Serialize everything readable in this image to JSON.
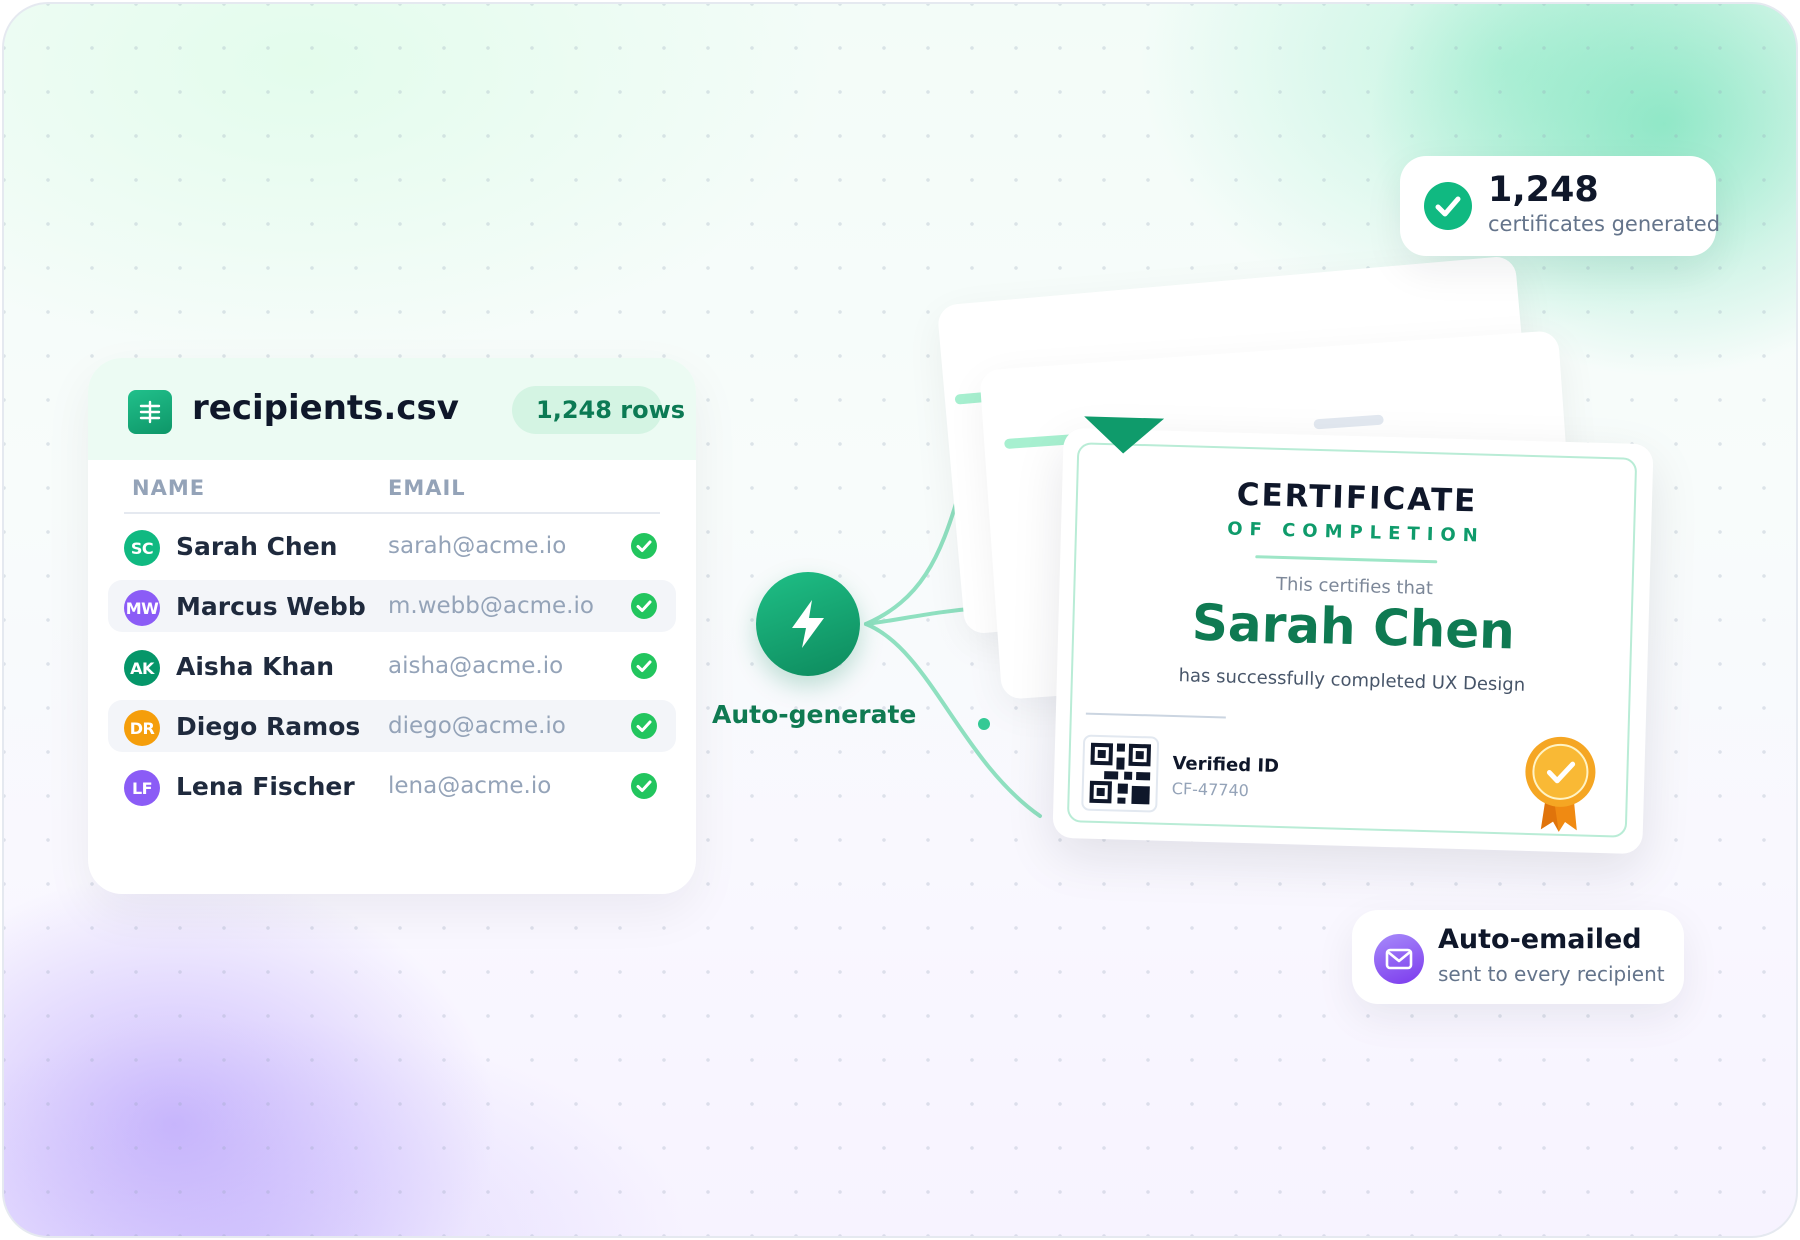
{
  "csv": {
    "filename": "recipients.csv",
    "rows_badge": "1,248 rows",
    "columns": [
      "NAME",
      "EMAIL"
    ],
    "rows": [
      {
        "initials": "SC",
        "name": "Sarah Chen",
        "email": "sarah@acme.io",
        "color": "#10b981"
      },
      {
        "initials": "MW",
        "name": "Marcus Webb",
        "email": "m.webb@acme.io",
        "color": "#8b5cf6"
      },
      {
        "initials": "AK",
        "name": "Aisha Khan",
        "email": "aisha@acme.io",
        "color": "#059669"
      },
      {
        "initials": "DR",
        "name": "Diego Ramos",
        "email": "diego@acme.io",
        "color": "#f59e0b"
      },
      {
        "initials": "LF",
        "name": "Lena Fischer",
        "email": "lena@acme.io",
        "color": "#8b5cf6"
      }
    ]
  },
  "action": {
    "label": "Auto-generate",
    "icon": "lightning-bolt-icon"
  },
  "certificate": {
    "title": "CERTIFICATE",
    "subtitle": "OF COMPLETION",
    "certifies": "This certifies that",
    "recipient": "Sarah Chen",
    "completed": "has successfully completed UX Design",
    "verified_label": "Verified ID",
    "verified_id": "CF-47740"
  },
  "stats": {
    "count": "1,248",
    "label": "certificates generated"
  },
  "email": {
    "title": "Auto-emailed",
    "subtitle": "sent to every recipient"
  },
  "colors": {
    "accent_green": "#10b981",
    "dark_green": "#0f7a52",
    "purple": "#8b5cf6",
    "gold": "#f59e0b"
  }
}
